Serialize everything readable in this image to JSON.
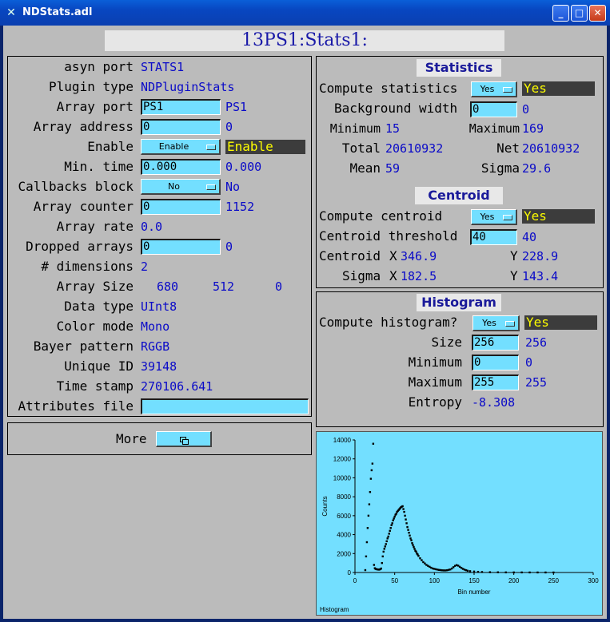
{
  "window": {
    "title": "NDStats.adl"
  },
  "header": {
    "title": "13PS1:Stats1:"
  },
  "left": {
    "asyn_port": {
      "label": "asyn port",
      "value": "STATS1"
    },
    "plugin_type": {
      "label": "Plugin type",
      "value": "NDPluginStats"
    },
    "array_port": {
      "label": "Array port",
      "input": "PS1",
      "value": "PS1"
    },
    "array_address": {
      "label": "Array address",
      "input": "0",
      "value": "0"
    },
    "enable": {
      "label": "Enable",
      "menu": "Enable",
      "status": "Enable"
    },
    "min_time": {
      "label": "Min. time",
      "input": "0.000",
      "value": "0.000"
    },
    "callbacks_block": {
      "label": "Callbacks block",
      "menu": "No",
      "value": "No"
    },
    "array_counter": {
      "label": "Array counter",
      "input": "0",
      "value": "1152"
    },
    "array_rate": {
      "label": "Array rate",
      "value": "0.0"
    },
    "dropped_arrays": {
      "label": "Dropped arrays",
      "input": "0",
      "value": "0"
    },
    "dimensions": {
      "label": "# dimensions",
      "value": "2"
    },
    "array_size": {
      "label": "Array Size",
      "values": [
        "680",
        "512",
        "0"
      ]
    },
    "data_type": {
      "label": "Data type",
      "value": "UInt8"
    },
    "color_mode": {
      "label": "Color mode",
      "value": "Mono"
    },
    "bayer_pattern": {
      "label": "Bayer pattern",
      "value": "RGGB"
    },
    "unique_id": {
      "label": "Unique ID",
      "value": "39148"
    },
    "time_stamp": {
      "label": "Time stamp",
      "value": "270106.641"
    },
    "attributes_file": {
      "label": "Attributes file",
      "input": ""
    }
  },
  "more": {
    "label": "More",
    "button_icon": "overlapping-windows-icon"
  },
  "statistics": {
    "heading": "Statistics",
    "compute": {
      "label": "Compute statistics",
      "menu": "Yes",
      "status": "Yes"
    },
    "bgwidth": {
      "label": "Background width",
      "input": "0",
      "value": "0"
    },
    "minimum": {
      "label": "Minimum",
      "value": "15"
    },
    "maximum": {
      "label": "Maximum",
      "value": "169"
    },
    "total": {
      "label": "Total",
      "value": "20610932"
    },
    "net": {
      "label": "Net",
      "value": "20610932"
    },
    "mean": {
      "label": "Mean",
      "value": "59"
    },
    "sigma": {
      "label": "Sigma",
      "value": "29.6"
    }
  },
  "centroid": {
    "heading": "Centroid",
    "compute": {
      "label": "Compute centroid",
      "menu": "Yes",
      "status": "Yes"
    },
    "threshold": {
      "label": "Centroid threshold",
      "input": "40",
      "value": "40"
    },
    "centroid_label": "Centroid",
    "sigma_label": "Sigma",
    "x_label": "X",
    "y_label": "Y",
    "cx": "346.9",
    "cy": "228.9",
    "sx": "182.5",
    "sy": "143.4"
  },
  "histogram": {
    "heading": "Histogram",
    "compute": {
      "label": "Compute histogram?",
      "menu": "Yes",
      "status": "Yes"
    },
    "size": {
      "label": "Size",
      "input": "256",
      "value": "256"
    },
    "minimum": {
      "label": "Minimum",
      "input": "0",
      "value": "0"
    },
    "maximum": {
      "label": "Maximum",
      "input": "255",
      "value": "255"
    },
    "entropy": {
      "label": "Entropy",
      "value": "-8.308"
    }
  },
  "chart_data": {
    "type": "scatter",
    "title": "",
    "footer": "Histogram",
    "xlabel": "Bin number",
    "ylabel": "Counts",
    "xlim": [
      0,
      300
    ],
    "ylim": [
      0,
      14000
    ],
    "xticks": [
      0,
      50,
      100,
      150,
      200,
      250,
      300
    ],
    "yticks": [
      0,
      2000,
      4000,
      6000,
      8000,
      10000,
      12000,
      14000
    ],
    "background": "#73dfff",
    "marker_color": "#000000",
    "x": [
      13,
      14,
      15,
      16,
      17,
      18,
      19,
      20,
      21,
      22,
      23,
      24,
      25,
      26,
      27,
      28,
      29,
      30,
      31,
      32,
      33,
      34,
      35,
      36,
      37,
      38,
      39,
      40,
      41,
      42,
      43,
      44,
      45,
      46,
      47,
      48,
      49,
      50,
      51,
      52,
      53,
      54,
      55,
      56,
      57,
      58,
      59,
      60,
      61,
      62,
      63,
      64,
      65,
      66,
      67,
      68,
      69,
      70,
      71,
      72,
      73,
      74,
      75,
      76,
      77,
      78,
      79,
      80,
      82,
      84,
      86,
      88,
      90,
      92,
      94,
      96,
      98,
      100,
      102,
      104,
      106,
      108,
      110,
      112,
      114,
      116,
      118,
      120,
      122,
      124,
      126,
      128,
      130,
      132,
      134,
      136,
      138,
      140,
      142,
      145,
      150,
      155,
      160,
      170,
      180,
      190,
      200,
      210,
      220,
      230,
      240,
      250
    ],
    "y": [
      250,
      1700,
      3200,
      4700,
      6000,
      7200,
      8500,
      9900,
      10800,
      11500,
      13600,
      800,
      450,
      380,
      350,
      330,
      320,
      300,
      320,
      350,
      420,
      1000,
      1700,
      2200,
      2500,
      2750,
      3000,
      3300,
      3600,
      3800,
      4100,
      4400,
      4700,
      5000,
      5200,
      5500,
      5700,
      5900,
      6100,
      6200,
      6400,
      6500,
      6600,
      6700,
      6800,
      6900,
      6950,
      7000,
      6700,
      6400,
      6000,
      5600,
      5200,
      4800,
      4500,
      4200,
      3900,
      3600,
      3400,
      3100,
      2900,
      2700,
      2500,
      2300,
      2200,
      2000,
      1900,
      1750,
      1500,
      1300,
      1100,
      950,
      800,
      700,
      600,
      500,
      420,
      380,
      340,
      300,
      270,
      250,
      230,
      220,
      220,
      240,
      280,
      320,
      420,
      560,
      700,
      780,
      720,
      600,
      480,
      380,
      300,
      240,
      180,
      140,
      100,
      70,
      50,
      30,
      20,
      12,
      10,
      8,
      6,
      5,
      4,
      3
    ]
  }
}
